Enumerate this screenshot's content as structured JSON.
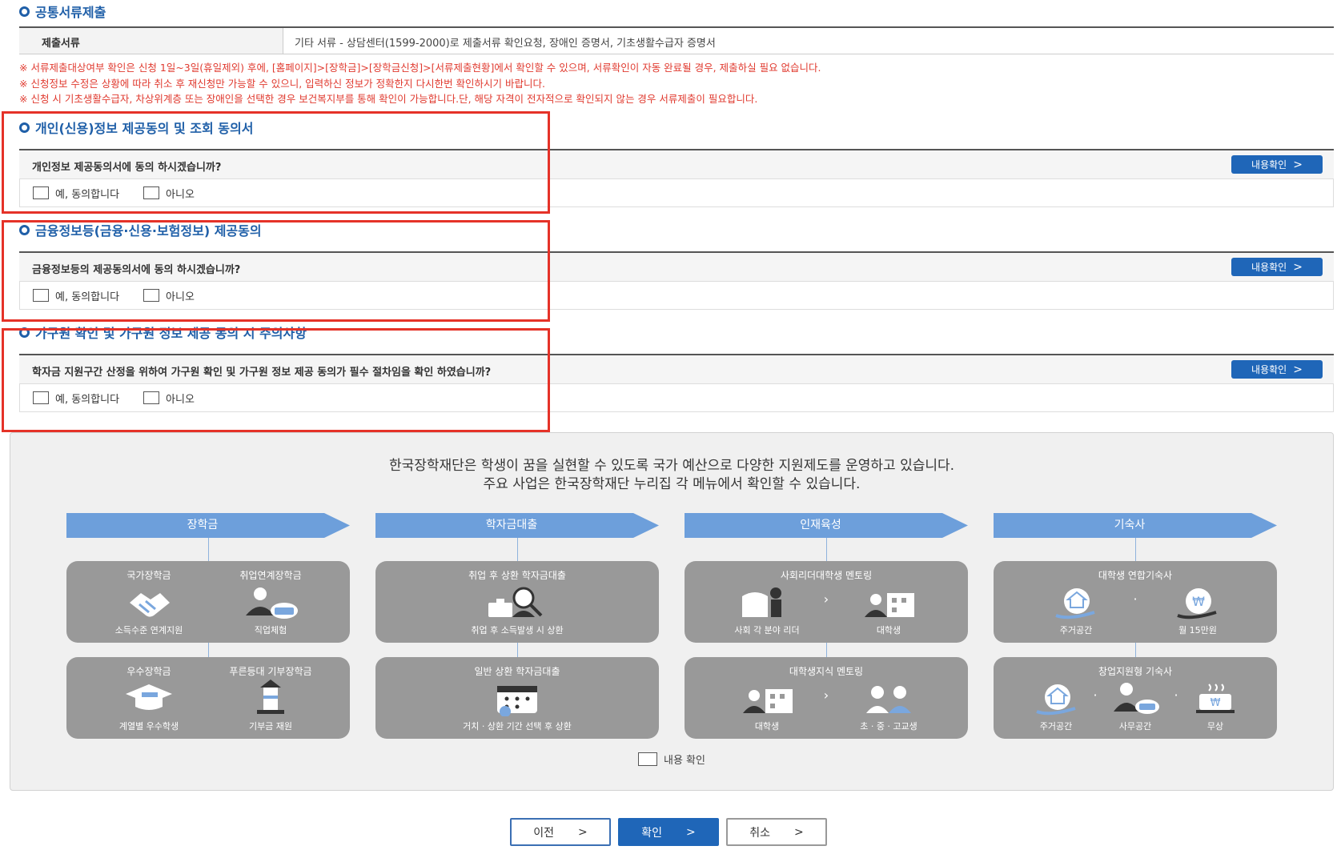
{
  "common_docs": {
    "title": "공통서류제출",
    "header": "제출서류",
    "value": "기타 서류 - 상담센터(1599-2000)로 제출서류 확인요청, 장애인 증명서, 기초생활수급자 증명서"
  },
  "notices": [
    "※ 서류제출대상여부 확인은 신청 1일~3일(휴일제외) 후에, [홈페이지]>[장학금]>[장학금신청]>[서류제출현황]에서 확인할 수 있으며, 서류확인이 자동 완료될 경우, 제출하실 필요 없습니다.",
    "※ 신청정보 수정은 상황에 따라 취소 후 재신청만 가능할 수 있으니, 입력하신 정보가 정확한지 다시한번 확인하시기 바랍니다.",
    "※ 신청 시 기초생활수급자, 차상위계층 또는 장애인을 선택한 경우 보건복지부를 통해 확인이 가능합니다.단, 해당 자격이 전자적으로 확인되지 않는 경우 서류제출이 필요합니다."
  ],
  "consents": [
    {
      "title": "개인(신용)정보 제공동의 및 조회 동의서",
      "question": "개인정보 제공동의서에 동의 하시겠습니까?",
      "yes": "예, 동의합니다",
      "no": "아니오",
      "view": "내용확인"
    },
    {
      "title": "금융정보등(금융·신용·보험정보) 제공동의",
      "question": "금융정보등의 제공동의서에 동의 하시겠습니까?",
      "yes": "예, 동의합니다",
      "no": "아니오",
      "view": "내용확인"
    },
    {
      "title": "가구원 확인 및 가구원 정보 제공 동의 시 주의사항",
      "question": "학자금 지원구간 산정을 위하여 가구원 확인 및 가구원 정보 제공 동의가 필수 절차임을 확인 하였습니까?",
      "yes": "예, 동의합니다",
      "no": "아니오",
      "view": "내용확인"
    }
  ],
  "promo": {
    "line1": "한국장학재단은 학생이 꿈을 실현할 수 있도록 국가 예산으로 다양한 지원제도를 운영하고 있습니다.",
    "line2": "주요 사업은 한국장학재단 누리집 각 메뉴에서 확인할 수 있습니다.",
    "columns": [
      "장학금",
      "학자금대출",
      "인재육성",
      "기숙사"
    ],
    "cards": {
      "c1a": {
        "left_title": "국가장학금",
        "left_sub": "소득수준 연계지원",
        "right_title": "취업연계장학금",
        "right_sub": "직업체험"
      },
      "c1b": {
        "left_title": "우수장학금",
        "left_sub": "계열별 우수학생",
        "right_title": "푸른등대 기부장학금",
        "right_sub": "기부금 재원"
      },
      "c2a": {
        "title": "취업 후 상환 학자금대출",
        "sub": "취업 후 소득발생 시 상환"
      },
      "c2b": {
        "title": "일반 상환 학자금대출",
        "sub": "거치 · 상환 기간 선택 후 상환"
      },
      "c3a": {
        "title": "사회리더대학생 멘토링",
        "left_sub": "사회 각 분야 리더",
        "right_sub": "대학생"
      },
      "c3b": {
        "title": "대학생지식 멘토링",
        "left_sub": "대학생",
        "right_sub": "초 · 중 · 고교생"
      },
      "c4a": {
        "title": "대학생 연합기숙사",
        "left_sub": "주거공간",
        "right_sub": "월 15만원"
      },
      "c4b": {
        "title": "창업지원형 기숙사",
        "sub1": "주거공간",
        "sub2": "사무공간",
        "sub3": "무상"
      }
    },
    "check_label": "내용 확인"
  },
  "buttons": {
    "prev": "이전",
    "ok": "확인",
    "cancel": "취소"
  },
  "colors": {
    "accent": "#1f66b8",
    "notice_red": "#e03a2f",
    "highlight_red": "#e53228",
    "card_gray": "#999999",
    "banner_blue": "#6d9fdb"
  }
}
